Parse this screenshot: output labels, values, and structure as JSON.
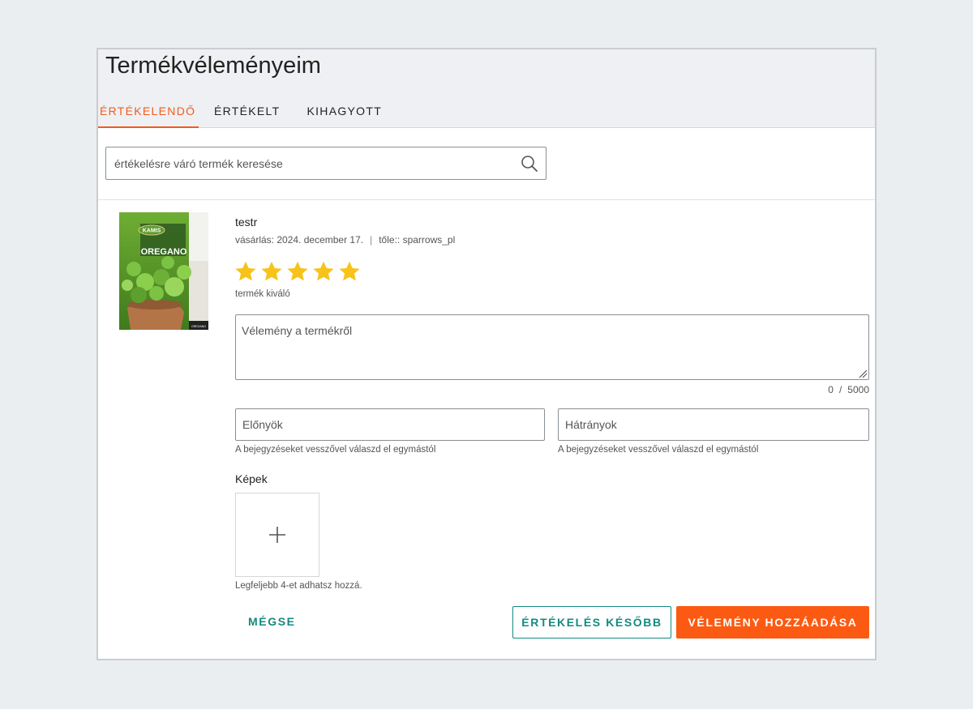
{
  "header": {
    "title": "Termékvéleményeim"
  },
  "tabs": [
    {
      "label": "ÉRTÉKELENDŐ",
      "active": true
    },
    {
      "label": "ÉRTÉKELT",
      "active": false
    },
    {
      "label": "KIHAGYOTT",
      "active": false
    }
  ],
  "search": {
    "placeholder": "értékelésre váró termék keresése",
    "value": ""
  },
  "product": {
    "name": "testr",
    "purchase_label": "vásárlás: 2024. december 17.",
    "separator": "|",
    "seller_label": "től​e:: sparrows_pl",
    "image_brand": "KAMIS",
    "image_name": "OREGANO",
    "image_small": "OREGANO"
  },
  "rating": {
    "value": 5,
    "max": 5,
    "label": "termék kiváló",
    "star_color": "#f7c31a"
  },
  "review": {
    "placeholder": "Vélemény a termékről",
    "value": "",
    "counter_current": "0",
    "counter_slash": "/",
    "counter_max": "5000"
  },
  "pros": {
    "placeholder": "Előnyök",
    "hint": "A bejegyzéseket vesszővel válaszd el egymástól"
  },
  "cons": {
    "placeholder": "Hátrányok",
    "hint": "A bejegyzéseket vesszővel válaszd el egymástól"
  },
  "images": {
    "label": "Képek",
    "add_icon": "plus-icon",
    "hint": "Legfeljebb 4-et adhatsz hozzá."
  },
  "actions": {
    "cancel_label": "MÉGSE",
    "later_label": "ÉRTÉKELÉS KÉSŐBB",
    "submit_label": "VÉLEMÉNY HOZZÁADÁSA"
  },
  "colors": {
    "accent": "#f35b1c",
    "primary_button": "#fc5a12",
    "teal": "#148a80"
  }
}
